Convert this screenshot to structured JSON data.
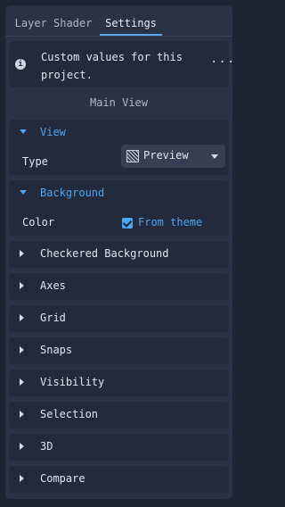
{
  "tabs": [
    {
      "label": "Layer Shader"
    },
    {
      "label": "Settings"
    }
  ],
  "info": {
    "line1": "Custom values for this",
    "line2": "project.",
    "icon": "info-icon",
    "more": "···"
  },
  "main_view": {
    "label": "Main View"
  },
  "view": {
    "title": "View",
    "type_label": "Type",
    "type_value": "Preview"
  },
  "background": {
    "title": "Background",
    "color_label": "Color",
    "from_theme_label": "From theme",
    "from_theme_checked": true
  },
  "sections": [
    {
      "title": "Checkered Background"
    },
    {
      "title": "Axes"
    },
    {
      "title": "Grid"
    },
    {
      "title": "Snaps"
    },
    {
      "title": "Visibility"
    },
    {
      "title": "Selection"
    },
    {
      "title": "3D"
    },
    {
      "title": "Compare"
    }
  ],
  "colors": {
    "accent": "#4da6f5",
    "panel": "#2b3245",
    "section": "#232a3b",
    "background": "#1f2433"
  }
}
